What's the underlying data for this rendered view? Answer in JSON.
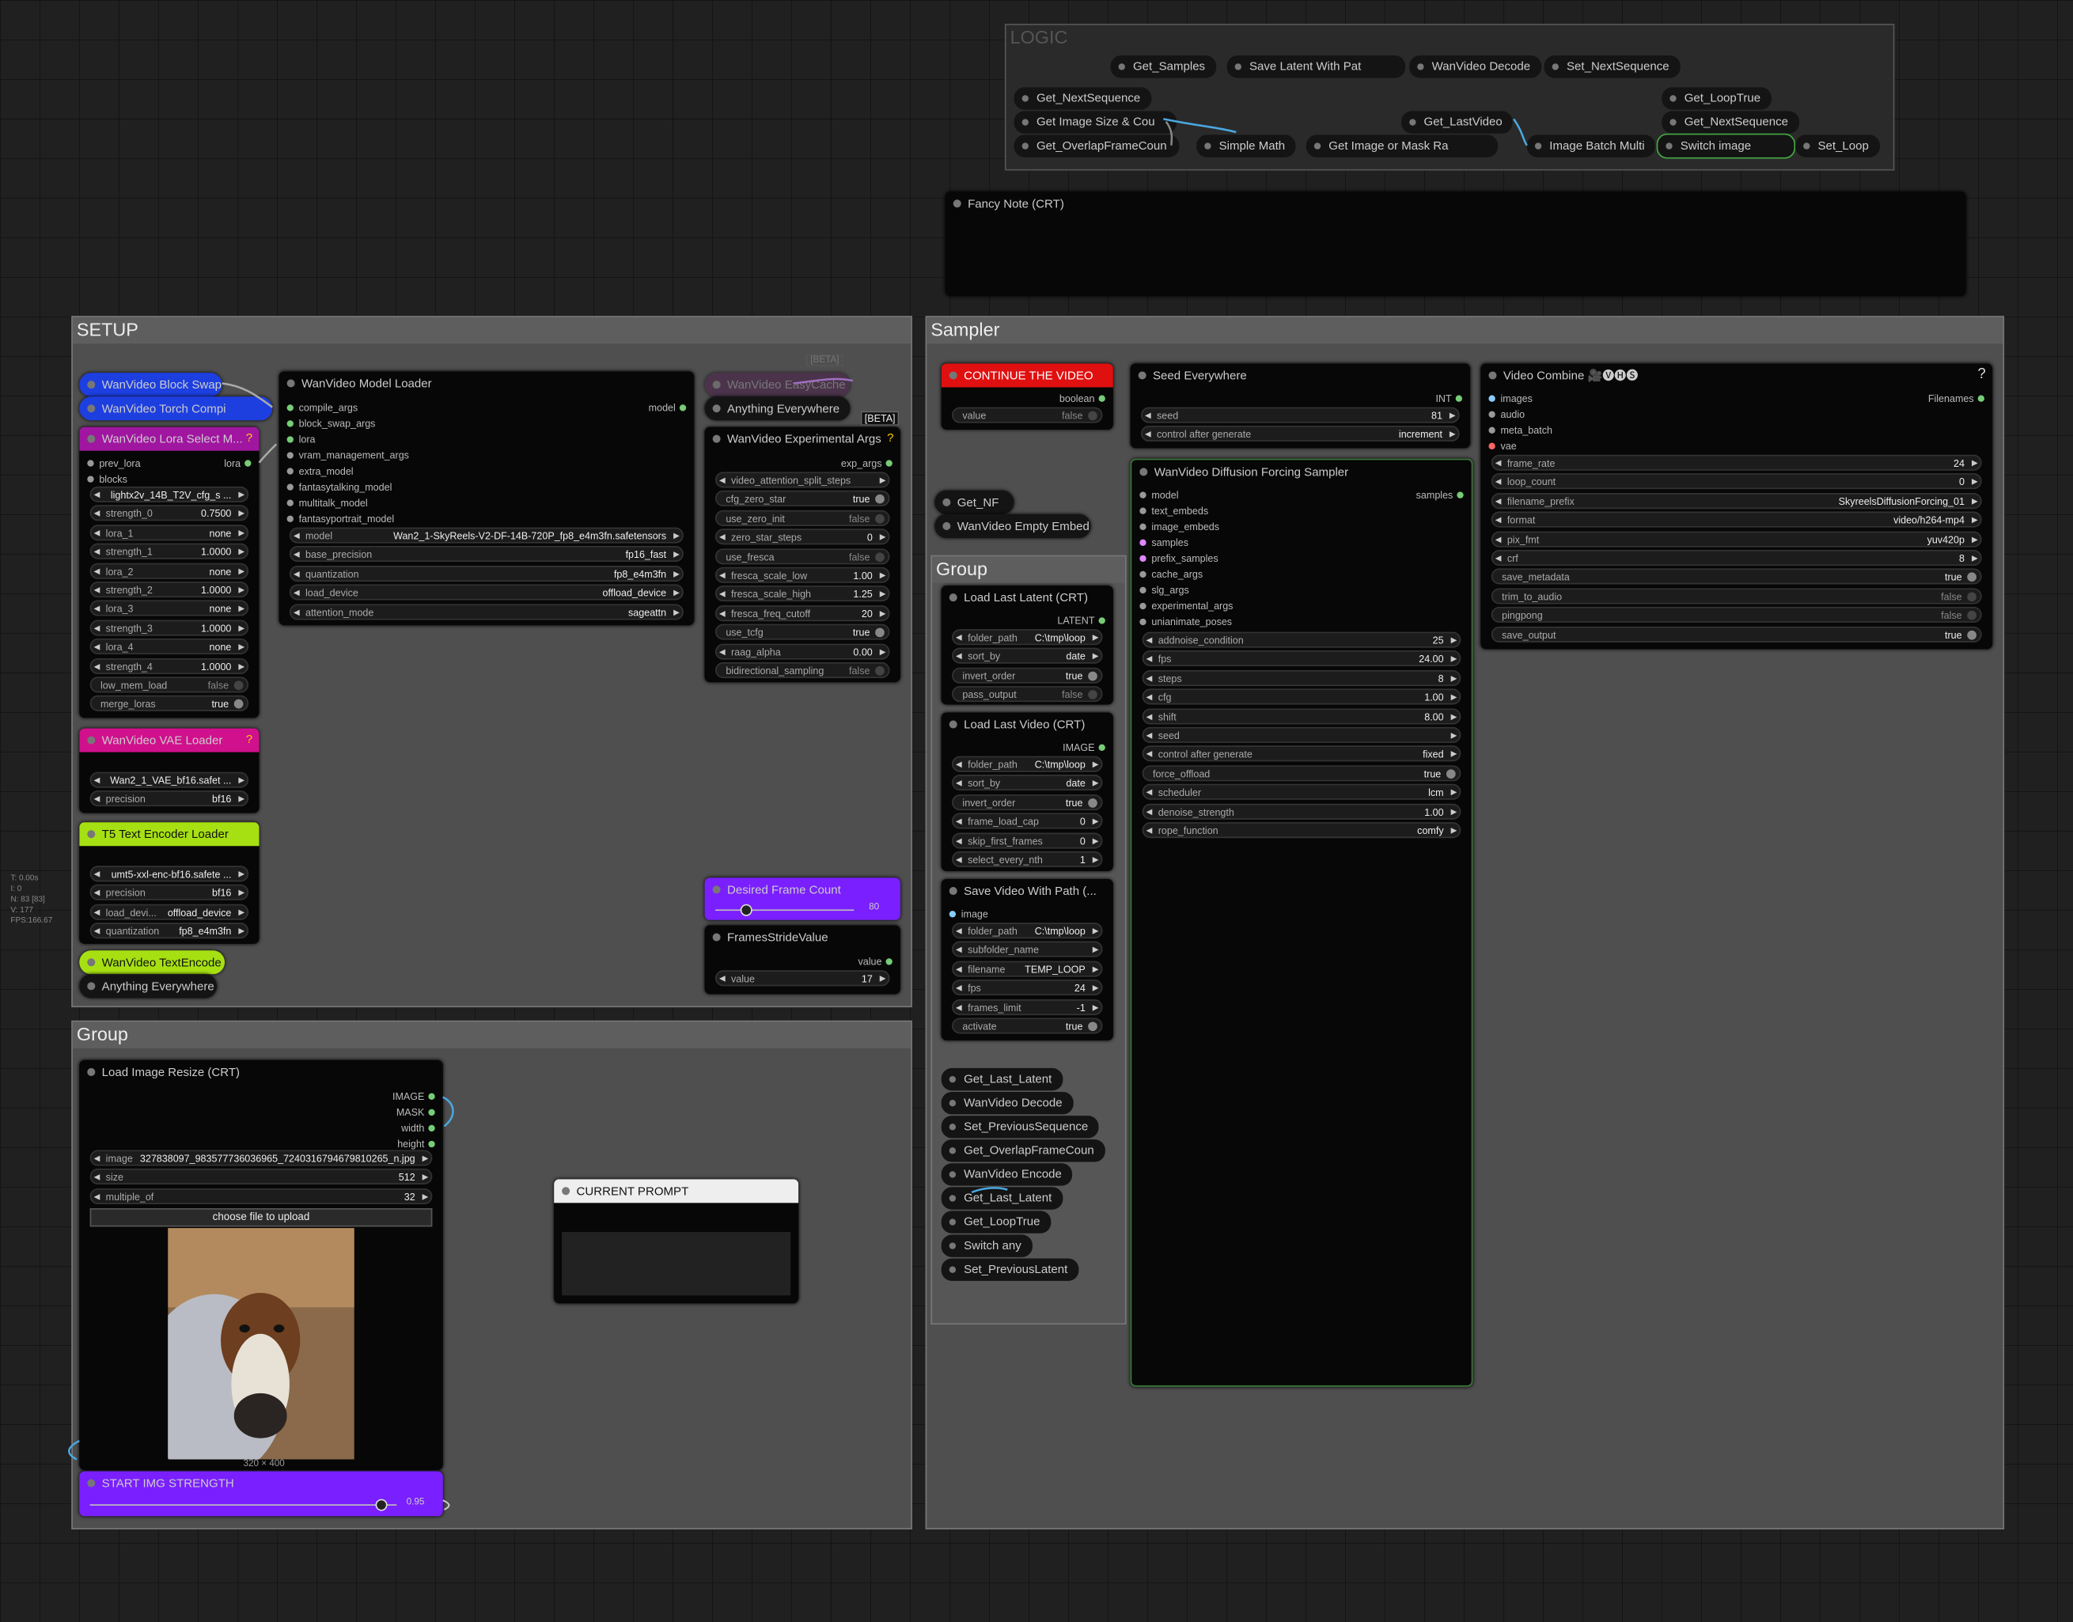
{
  "stats": [
    "T: 0.00s",
    "I: 0",
    "N: 83 [83]",
    "V: 177",
    "FPS:166.67"
  ],
  "groups": {
    "logic": "LOGIC",
    "setup": "SETUP",
    "sampler": "Sampler",
    "group_left": "Group",
    "group_inner": "Group"
  },
  "logic": {
    "get_samples": "Get_Samples",
    "save_latent": "Save Latent With Pat",
    "wan_decode": "WanVideo Decode",
    "set_next_seq": "Set_NextSequence",
    "get_next_seq": "Get_NextSequence",
    "get_image_size": "Get Image Size & Cou",
    "get_overlap": "Get_OverlapFrameCoun",
    "simple_math": "Simple Math",
    "get_image_mask": "Get Image or Mask Ra",
    "get_last_video": "Get_LastVideo",
    "image_batch": "Image Batch Multi",
    "get_loop_true": "Get_LoopTrue",
    "get_next_seq2": "Get_NextSequence",
    "switch_image": "Switch image",
    "set_loop": "Set_Loop"
  },
  "fancy_note": "Fancy Note (CRT)",
  "setup": {
    "block_swap": "WanVideo Block Swap",
    "torch_compile": "WanVideo Torch Compi",
    "lora_select": "WanVideo Lora Select M...",
    "lora_prev": "prev_lora",
    "lora_out": "lora",
    "lora_blocks": "blocks",
    "lora_widgets": [
      {
        "l": "",
        "v": "lightx2v_14B_T2V_cfg_s ..."
      },
      {
        "l": "strength_0",
        "v": "0.7500"
      },
      {
        "l": "lora_1",
        "v": "none"
      },
      {
        "l": "strength_1",
        "v": "1.0000"
      },
      {
        "l": "lora_2",
        "v": "none"
      },
      {
        "l": "strength_2",
        "v": "1.0000"
      },
      {
        "l": "lora_3",
        "v": "none"
      },
      {
        "l": "strength_3",
        "v": "1.0000"
      },
      {
        "l": "lora_4",
        "v": "none"
      },
      {
        "l": "strength_4",
        "v": "1.0000"
      }
    ],
    "low_mem_load": {
      "l": "low_mem_load",
      "v": "false"
    },
    "merge_loras": {
      "l": "merge_loras",
      "v": "true"
    },
    "vae_loader": "WanVideo VAE Loader",
    "vae_widgets": [
      {
        "l": "",
        "v": "Wan2_1_VAE_bf16.safet ..."
      },
      {
        "l": "precision",
        "v": "bf16"
      }
    ],
    "t5_loader": "T5 Text Encoder Loader",
    "t5_widgets": [
      {
        "l": "",
        "v": "umt5-xxl-enc-bf16.safete ..."
      },
      {
        "l": "precision",
        "v": "bf16"
      },
      {
        "l": "load_devi...",
        "v": "offload_device"
      },
      {
        "l": "quantization",
        "v": "fp8_e4m3fn"
      }
    ],
    "text_encode": "WanVideo TextEncode",
    "anything_everywhere": "Anything Everywhere",
    "model_loader": "WanVideo Model Loader",
    "model_out": "model",
    "model_inputs": [
      "compile_args",
      "block_swap_args",
      "lora",
      "vram_management_args",
      "extra_model",
      "fantasytalking_model",
      "multitalk_model",
      "fantasyportrait_model"
    ],
    "model_widgets": [
      {
        "l": "model",
        "v": "Wan2_1-SkyReels-V2-DF-14B-720P_fp8_e4m3fn.safetensors"
      },
      {
        "l": "base_precision",
        "v": "fp16_fast"
      },
      {
        "l": "quantization",
        "v": "fp8_e4m3fn"
      },
      {
        "l": "load_device",
        "v": "offload_device"
      },
      {
        "l": "attention_mode",
        "v": "sageattn"
      }
    ],
    "easycache": "WanVideo EasyCache",
    "beta": "[BETA]",
    "beta2": "[BETA]",
    "anything_everywhere2": "Anything Everywhere",
    "exp_args": "WanVideo Experimental Args",
    "exp_out": "exp_args",
    "exp_widgets": [
      {
        "l": "video_attention_split_steps",
        "v": ""
      },
      {
        "l": "cfg_zero_star",
        "v": "true"
      },
      {
        "l": "use_zero_init",
        "v": "false"
      },
      {
        "l": "zero_star_steps",
        "v": "0"
      },
      {
        "l": "use_fresca",
        "v": "false"
      },
      {
        "l": "fresca_scale_low",
        "v": "1.00"
      },
      {
        "l": "fresca_scale_high",
        "v": "1.25"
      },
      {
        "l": "fresca_freq_cutoff",
        "v": "20"
      },
      {
        "l": "use_tcfg",
        "v": "true"
      },
      {
        "l": "raag_alpha",
        "v": "0.00"
      },
      {
        "l": "bidirectional_sampling",
        "v": "false"
      }
    ],
    "desired_frame": "Desired Frame Count",
    "desired_value": "80",
    "frames_stride": "FramesStrideValue",
    "stride_out": "value",
    "stride_widget": {
      "l": "value",
      "v": "17"
    }
  },
  "left_group": {
    "load_image": "Load Image Resize (CRT)",
    "outs": [
      "IMAGE",
      "MASK",
      "width",
      "height"
    ],
    "widgets": [
      {
        "l": "image",
        "v": "327838097_983577736036965_7240316794679810265_n.jpg"
      },
      {
        "l": "size",
        "v": "512"
      },
      {
        "l": "multiple_of",
        "v": "32"
      }
    ],
    "upload": "choose file to upload",
    "img_size": "320 × 400",
    "start_strength": "START IMG STRENGTH",
    "strength_value": "0.95",
    "current_prompt": "CURRENT PROMPT"
  },
  "sampler": {
    "continue": "CONTINUE THE VIDEO",
    "boolean": "boolean",
    "value_w": {
      "l": "value",
      "v": "false"
    },
    "seed_everywhere": "Seed Everywhere",
    "int_out": "INT",
    "seed_widgets": [
      {
        "l": "seed",
        "v": "81"
      },
      {
        "l": "control after generate",
        "v": "increment"
      }
    ],
    "get_nf": "Get_NF",
    "empty_embed": "WanVideo Empty Embed",
    "dfs": "WanVideo Diffusion Forcing Sampler",
    "dfs_out": "samples",
    "dfs_inputs": [
      "model",
      "text_embeds",
      "image_embeds",
      "samples",
      "prefix_samples",
      "cache_args",
      "slg_args",
      "experimental_args",
      "unianimate_poses"
    ],
    "dfs_widgets": [
      {
        "l": "addnoise_condition",
        "v": "25"
      },
      {
        "l": "fps",
        "v": "24.00"
      },
      {
        "l": "steps",
        "v": "8"
      },
      {
        "l": "cfg",
        "v": "1.00"
      },
      {
        "l": "shift",
        "v": "8.00"
      },
      {
        "l": "seed",
        "v": ""
      },
      {
        "l": "control after generate",
        "v": "fixed"
      },
      {
        "l": "force_offload",
        "v": "true"
      },
      {
        "l": "scheduler",
        "v": "lcm"
      },
      {
        "l": "denoise_strength",
        "v": "1.00"
      },
      {
        "l": "rope_function",
        "v": "comfy"
      }
    ],
    "video_combine": "Video Combine 🎥🅥🅗🅢",
    "filenames": "Filenames",
    "vc_inputs": [
      "images",
      "audio",
      "meta_batch",
      "vae"
    ],
    "vc_widgets": [
      {
        "l": "frame_rate",
        "v": "24"
      },
      {
        "l": "loop_count",
        "v": "0"
      },
      {
        "l": "filename_prefix",
        "v": "SkyreelsDiffusionForcing_01"
      },
      {
        "l": "format",
        "v": "video/h264-mp4"
      },
      {
        "l": "pix_fmt",
        "v": "yuv420p"
      },
      {
        "l": "crf",
        "v": "8"
      },
      {
        "l": "save_metadata",
        "v": "true"
      },
      {
        "l": "trim_to_audio",
        "v": "false"
      },
      {
        "l": "pingpong",
        "v": "false"
      },
      {
        "l": "save_output",
        "v": "true"
      }
    ],
    "load_latent": "Load Last Latent (CRT)",
    "latent_out": "LATENT",
    "latent_widgets": [
      {
        "l": "folder_path",
        "v": "C:\\tmp\\loop"
      },
      {
        "l": "sort_by",
        "v": "date"
      },
      {
        "l": "invert_order",
        "v": "true"
      },
      {
        "l": "pass_output",
        "v": "false"
      }
    ],
    "load_video": "Load Last Video (CRT)",
    "image_out": "IMAGE",
    "video_widgets": [
      {
        "l": "folder_path",
        "v": "C:\\tmp\\loop"
      },
      {
        "l": "sort_by",
        "v": "date"
      },
      {
        "l": "invert_order",
        "v": "true"
      },
      {
        "l": "frame_load_cap",
        "v": "0"
      },
      {
        "l": "skip_first_frames",
        "v": "0"
      },
      {
        "l": "select_every_nth",
        "v": "1"
      }
    ],
    "save_video": "Save Video With Path (...",
    "image_in": "image",
    "save_widgets": [
      {
        "l": "folder_path",
        "v": "C:\\tmp\\loop"
      },
      {
        "l": "subfolder_name",
        "v": ""
      },
      {
        "l": "filename",
        "v": "TEMP_LOOP"
      },
      {
        "l": "fps",
        "v": "24"
      },
      {
        "l": "frames_limit",
        "v": "-1"
      },
      {
        "l": "activate",
        "v": "true"
      }
    ],
    "chips": [
      "Get_Last_Latent",
      "WanVideo Decode",
      "Set_PreviousSequence",
      "Get_OverlapFrameCoun",
      "WanVideo Encode",
      "Get_Last_Latent",
      "Get_LoopTrue",
      "Switch any",
      "Set_PreviousLatent"
    ]
  },
  "colors": {
    "accent": "#7a1fff",
    "red": "#e01010",
    "magenta": "#a016a0",
    "pink": "#d0108c",
    "lime": "#a6e012",
    "blue": "#1d3fe0"
  }
}
